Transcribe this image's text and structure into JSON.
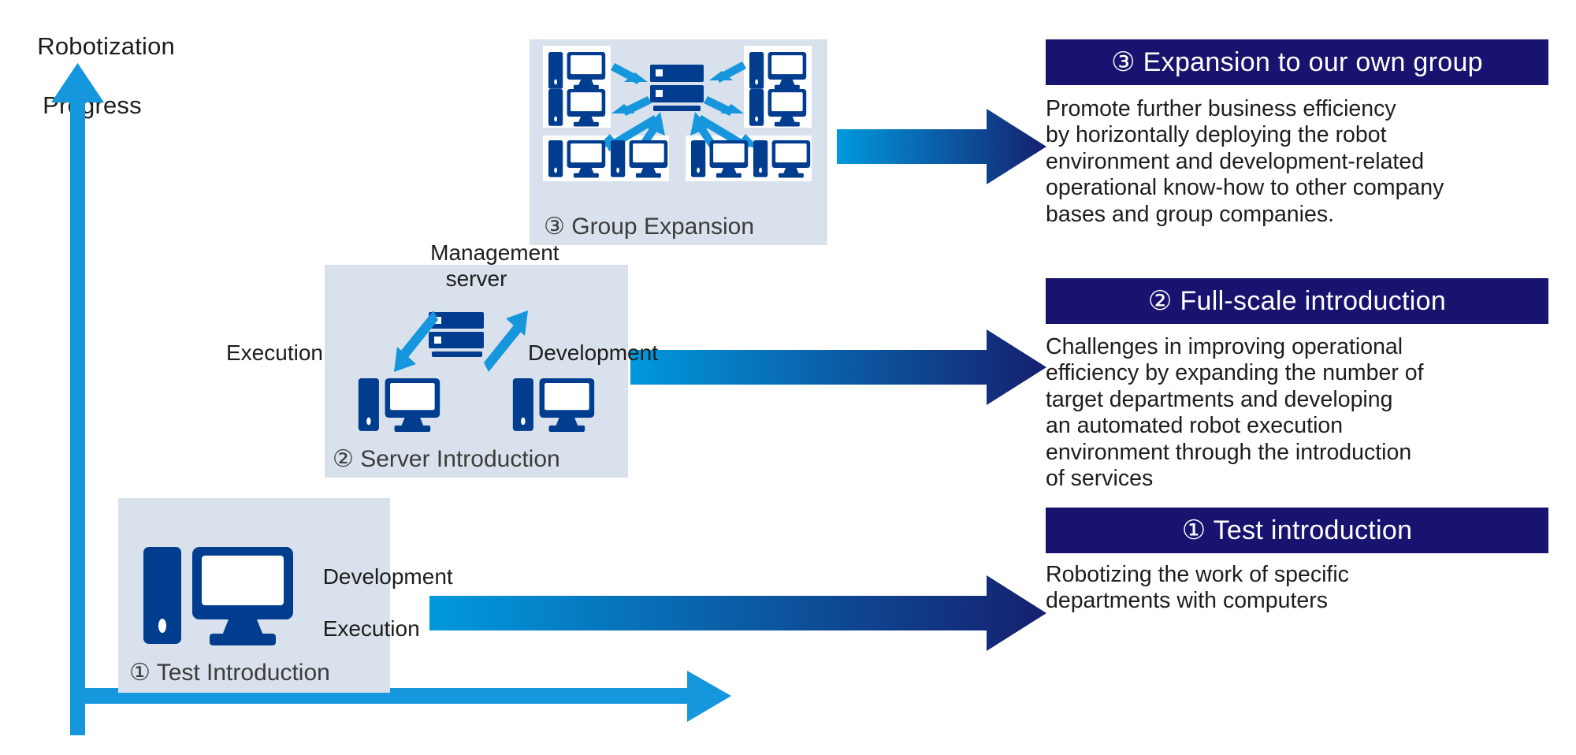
{
  "axis": {
    "y_label_line1": "Robotization",
    "y_label_line2": "Progress",
    "y_arrow_icon": "up-arrow-icon",
    "x_arrow_icon": "right-arrow-icon",
    "color": "#1596dd"
  },
  "colors": {
    "panel_bg": "#d9e1ec",
    "navy_header": "#191370",
    "icon_blue": "#003d8f",
    "accent_blue": "#1596dd",
    "arrow_gradient_start": "#0099dd",
    "arrow_gradient_end": "#15206e",
    "text_dark": "#1d1d1b"
  },
  "panels": [
    {
      "id": "test-introduction",
      "caption": "① Test Introduction",
      "labels": [
        "Development",
        "Execution"
      ],
      "icons": [
        "desktop-computer-icon"
      ]
    },
    {
      "id": "server-introduction",
      "caption": "② Server Introduction",
      "title": "Management\nserver",
      "label_left": "Execution",
      "label_right": "Development",
      "icons": [
        "server-rack-icon",
        "desktop-computer-icon",
        "desktop-computer-icon",
        "arrow-down-left-icon",
        "arrow-up-right-icon"
      ]
    },
    {
      "id": "group-expansion",
      "caption": "③ Group Expansion",
      "icons": [
        "server-rack-icon",
        "desktop-computer-icon",
        "network-arrow-icon"
      ]
    }
  ],
  "stages": [
    {
      "id": "stage-3",
      "header": "③ Expansion to our own group",
      "body": "Promote further business efficiency\nby horizontally deploying the robot\nenvironment and development-related\noperational know-how to other company\nbases and group companies."
    },
    {
      "id": "stage-2",
      "header": "② Full-scale introduction",
      "body": "Challenges in improving operational\nefficiency by expanding the number of\ntarget departments and developing\nan automated robot execution\nenvironment through the introduction\nof services"
    },
    {
      "id": "stage-1",
      "header": "① Test introduction",
      "body": "Robotizing the work of specific\ndepartments with computers"
    }
  ]
}
